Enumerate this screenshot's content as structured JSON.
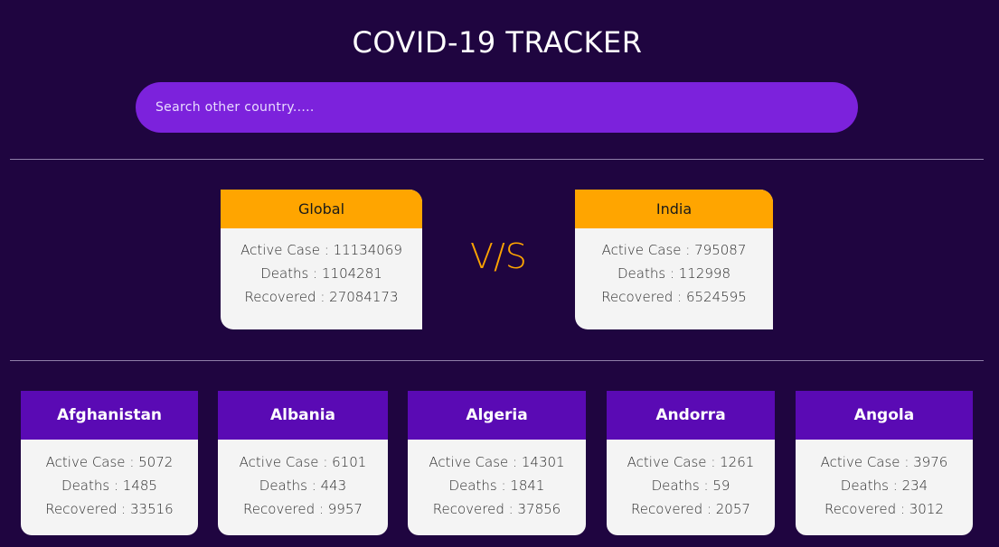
{
  "header": {
    "title": "COVID-19 TRACKER"
  },
  "search": {
    "placeholder": "Search other country....."
  },
  "labels": {
    "active": "Active Case",
    "deaths": "Deaths",
    "recovered": "Recovered"
  },
  "comparison": {
    "separator": "V/S",
    "global": {
      "name": "Global",
      "active": "11134069",
      "deaths": "1104281",
      "recovered": "27084173"
    },
    "selected": {
      "name": "India",
      "active": "795087",
      "deaths": "112998",
      "recovered": "6524595"
    }
  },
  "countries": [
    {
      "name": "Afghanistan",
      "active": "5072",
      "deaths": "1485",
      "recovered": "33516"
    },
    {
      "name": "Albania",
      "active": "6101",
      "deaths": "443",
      "recovered": "9957"
    },
    {
      "name": "Algeria",
      "active": "14301",
      "deaths": "1841",
      "recovered": "37856"
    },
    {
      "name": "Andorra",
      "active": "1261",
      "deaths": "59",
      "recovered": "2057"
    },
    {
      "name": "Angola",
      "active": "3976",
      "deaths": "234",
      "recovered": "3012"
    }
  ],
  "colors": {
    "background": "#1f0540",
    "search": "#7c22dc",
    "accent": "#ffa500",
    "country_header": "#5a0ab4",
    "card": "#f4f4f4"
  }
}
